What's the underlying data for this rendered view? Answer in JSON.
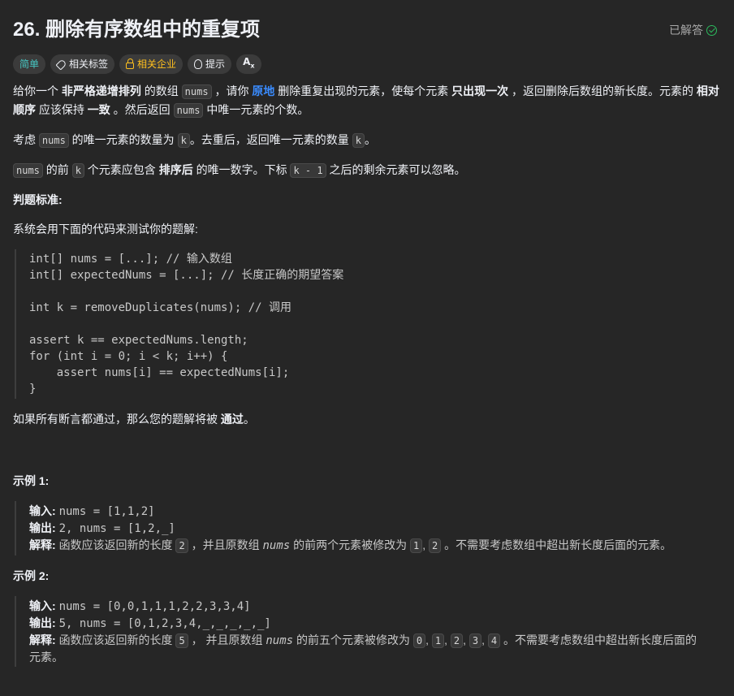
{
  "problem": {
    "title": "26. 删除有序数组中的重复项",
    "status": "已解答"
  },
  "tags": {
    "difficulty": "简单",
    "topics": "相关标签",
    "companies": "相关企业",
    "hint": "提示",
    "font": "A"
  },
  "desc": {
    "p1": [
      "给你一个 ",
      "非严格递增排列",
      " 的数组 ",
      "nums",
      " ，请你 ",
      "原地",
      " 删除重复出现的元素，使每个元素 ",
      "只出现一次",
      " ，返回删除后数组的新长度。元素的 ",
      "相对顺序",
      " 应该保持 ",
      "一致",
      " 。然后返回 ",
      "nums",
      " 中唯一元素的个数。"
    ],
    "p2": [
      "考虑 ",
      "nums",
      " 的唯一元素的数量为 ",
      "k",
      "。去重后，返回唯一元素的数量 ",
      "k",
      "。"
    ],
    "p3": [
      "nums",
      " 的前 ",
      "k",
      " 个元素应包含 ",
      "排序后",
      " 的唯一数字。下标 ",
      "k - 1",
      " 之后的剩余元素可以忽略。"
    ],
    "judge_heading": "判题标准:",
    "judge_text": "系统会用下面的代码来测试你的题解:",
    "code": [
      "int[] nums = [...]; // 输入数组",
      "int[] expectedNums = [...]; // 长度正确的期望答案",
      "",
      "int k = removeDuplicates(nums); // 调用",
      "",
      "assert k == expectedNums.length;",
      "for (int i = 0; i < k; i++) {",
      "    assert nums[i] == expectedNums[i];",
      "}"
    ],
    "pass": [
      "如果所有断言都通过，那么您的题解将被 ",
      "通过",
      "。"
    ]
  },
  "examples": [
    {
      "heading": "示例 1:",
      "input_label": "输入:",
      "input": "nums = [1,1,2]",
      "output_label": "输出:",
      "output": "2, nums = [1,2,_]",
      "expl_label": "解释:",
      "expl": [
        "函数应该返回新的长度 ",
        "2",
        " ，并且原数组 ",
        "nums",
        " 的前两个元素被修改为 ",
        "1",
        ", ",
        "2",
        " 。",
        "不需要考虑数组中超出新长度后面的元素。"
      ]
    },
    {
      "heading": "示例 2:",
      "input_label": "输入:",
      "input": "nums = [0,0,1,1,1,2,2,3,3,4]",
      "output_label": "输出:",
      "output": "5, nums = [0,1,2,3,4,_,_,_,_,_]",
      "expl_label": "解释:",
      "expl": [
        "函数应该返回新的长度 ",
        "5",
        " ， 并且原数组 ",
        "nums",
        " 的前五个元素被修改为 ",
        "0",
        ", ",
        "1",
        ", ",
        "2",
        ", ",
        "3",
        ", ",
        "4",
        " 。不需要考虑数组中超出新长度后面的元素。"
      ]
    }
  ],
  "colors": {
    "background": "#262626",
    "text": "#eff1f6",
    "easy": "#46c6c2",
    "company": "#ffc01e",
    "link": "#3a8cff",
    "solved": "#2cbb5d"
  }
}
